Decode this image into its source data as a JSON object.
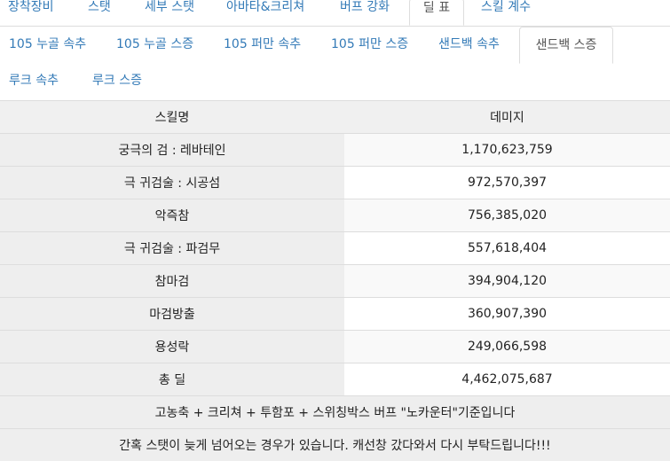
{
  "top_tabs": [
    {
      "label": "장착장비"
    },
    {
      "label": "스탯"
    },
    {
      "label": "세부 스탯"
    },
    {
      "label": "아바타&크리쳐"
    },
    {
      "label": "버프 강화"
    },
    {
      "label": "딜 표"
    },
    {
      "label": "스킬 계수"
    }
  ],
  "sub_tabs": [
    {
      "label": "105 누골 속추"
    },
    {
      "label": "105 누골 스증"
    },
    {
      "label": "105 퍼만 속추"
    },
    {
      "label": "105 퍼만 스증"
    },
    {
      "label": "샌드백 속추"
    },
    {
      "label": "샌드백 스증"
    },
    {
      "label": "루크 속추"
    },
    {
      "label": "루크 스증"
    }
  ],
  "table": {
    "header": {
      "skill": "스킬명",
      "damage": "데미지"
    },
    "rows": [
      {
        "skill": "궁극의 검 : 레바테인",
        "damage": "1,170,623,759"
      },
      {
        "skill": "극 귀검술 : 시공섬",
        "damage": "972,570,397"
      },
      {
        "skill": "악즉참",
        "damage": "756,385,020"
      },
      {
        "skill": "극 귀검술 : 파검무",
        "damage": "557,618,404"
      },
      {
        "skill": "참마검",
        "damage": "394,904,120"
      },
      {
        "skill": "마검방출",
        "damage": "360,907,390"
      },
      {
        "skill": "용성락",
        "damage": "249,066,598"
      },
      {
        "skill": "총 딜",
        "damage": "4,462,075,687"
      }
    ],
    "note1": "고농축 + 크리쳐 + 투함포 + 스위칭박스 버프 \"노카운터\"기준입니다",
    "note2": "간혹 스탯이 늦게 넘어오는 경우가 있습니다. 캐선창 갔다와서 다시 부탁드립니다!!!"
  }
}
